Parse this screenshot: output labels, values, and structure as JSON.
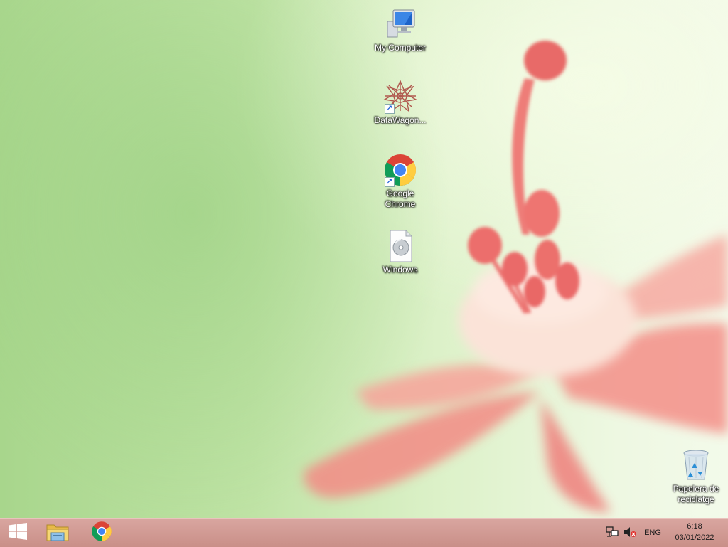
{
  "desktop": {
    "icons": [
      {
        "label": "My Computer",
        "icon": "my-computer-icon"
      },
      {
        "label": "DataWagon...",
        "icon": "datawagon-icon"
      },
      {
        "label": "Google Chrome",
        "icon": "chrome-icon"
      },
      {
        "label": "Windows",
        "icon": "disc-image-file-icon"
      },
      {
        "label": "Papelera de reciclatge",
        "icon": "recycle-bin-icon"
      }
    ]
  },
  "taskbar": {
    "pinned": [
      {
        "name": "start",
        "icon": "windows-logo-icon"
      },
      {
        "name": "file-explorer",
        "icon": "file-explorer-icon"
      },
      {
        "name": "chrome",
        "icon": "chrome-icon"
      }
    ],
    "tray": {
      "network_icon": "network-icon",
      "volume_icon": "volume-muted-icon",
      "language": "ENG",
      "time": "6:18",
      "date": "03/01/2022"
    }
  },
  "colors": {
    "taskbar": "#cf978f",
    "flower": "#f07a78",
    "wallpaper_green": "#bfe3a5"
  }
}
